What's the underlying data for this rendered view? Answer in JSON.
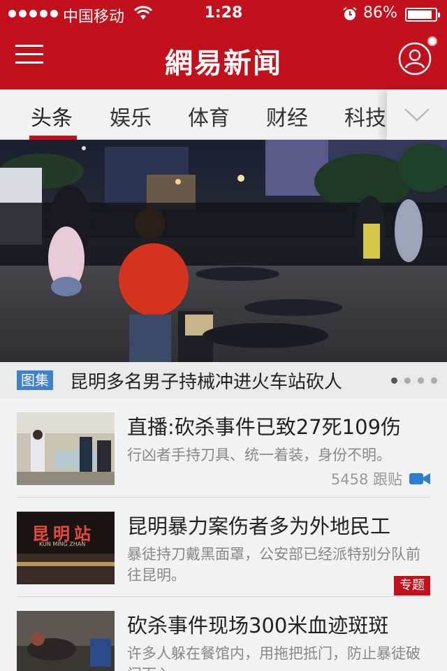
{
  "status_bar": {
    "carrier": "中国移动",
    "time": "1:28",
    "battery_percent": "86%"
  },
  "header": {
    "title": "網易新闻"
  },
  "tabs": [
    {
      "label": "头条",
      "active": true
    },
    {
      "label": "娱乐",
      "active": false
    },
    {
      "label": "体育",
      "active": false
    },
    {
      "label": "财经",
      "active": false
    },
    {
      "label": "科技",
      "active": false
    }
  ],
  "hero": {
    "badge": "图集",
    "title": "昆明多名男子持械冲进火车站砍人",
    "dots_total": 4,
    "dots_active_index": 0
  },
  "news": [
    {
      "title": "直播:砍杀事件已致27死109伤",
      "summary": "行凶者手持刀具、统一着装，身份不明。",
      "comments": "5458 跟贴",
      "icon": "video-camera-icon"
    },
    {
      "title": "昆明暴力案伤者多为外地民工",
      "summary": "暴徒持刀戴黑面罩，公安部已经派特别分队前往昆明。",
      "tag": "专题",
      "thumb_sign": "昆明站",
      "thumb_sign_sub": "KUN MING ZHAN"
    },
    {
      "title": "砍杀事件现场300米血迹斑斑",
      "summary": "许多人躲在餐馆内，用拖把抵门，防止暴徒破门而入。"
    }
  ],
  "colors": {
    "brand_red": "#c2101c",
    "badge_blue": "#3f82c7",
    "video_icon_blue": "#2f7fd1"
  }
}
